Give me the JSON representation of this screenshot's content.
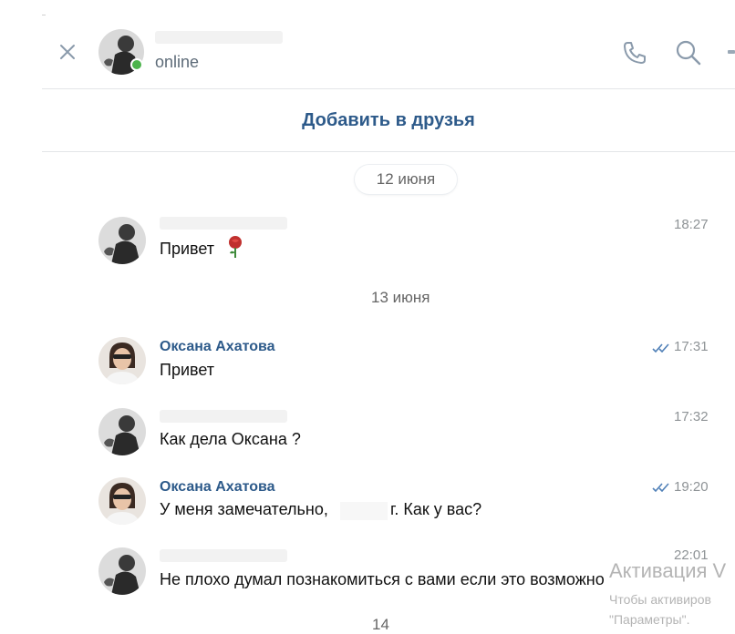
{
  "header": {
    "status": "online",
    "close_icon": "close-icon",
    "call_icon": "phone-icon",
    "search_icon": "search-icon",
    "more_icon": "more-icon"
  },
  "add_friend_label": "Добавить в друзья",
  "dates": {
    "first": "12 июня",
    "second": "13 июня",
    "third": "14"
  },
  "messages": [
    {
      "sender": "",
      "text": "Привет",
      "time": "18:27",
      "emoji": "rose-icon"
    },
    {
      "sender": "Оксана Ахатова",
      "text": "Привет",
      "time": "17:31",
      "status_icon": "read-icon"
    },
    {
      "sender": "",
      "text": "Как дела Оксана ?",
      "time": "17:32"
    },
    {
      "sender": "Оксана Ахатова",
      "text_before": "У меня замечательно,",
      "text_after": "г. Как у вас?",
      "time": "19:20",
      "status_icon": "read-icon"
    },
    {
      "sender": "",
      "text": "Не плохо думал познакомиться с вами если это возможно",
      "time": "22:01"
    }
  ],
  "watermark": {
    "title": "Активация V",
    "line1": "Чтобы активиров",
    "line2": "\"Параметры\"."
  },
  "colors": {
    "link": "#2d5a8a",
    "online": "#4bb34b",
    "read_check": "#5181b8",
    "muted": "#8e9396"
  }
}
